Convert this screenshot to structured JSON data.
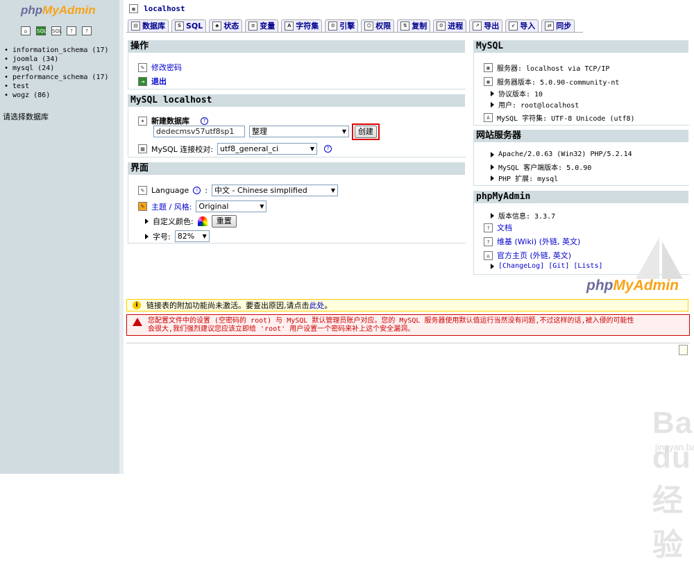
{
  "left": {
    "logo_a": "php",
    "logo_b": "MyAdmin",
    "nav_icons": [
      "home-icon",
      "sql-query-icon",
      "sql-icon",
      "docs-icon",
      "help-icon"
    ],
    "databases": [
      "information_schema (17)",
      "joomla (34)",
      "mysql (24)",
      "performance_schema (17)",
      "test",
      "wogz (86)"
    ],
    "select_db": "请选择数据库"
  },
  "header": {
    "server": "localhost",
    "tabs": [
      "数据库",
      "SQL",
      "状态",
      "变量",
      "字符集",
      "引擎",
      "权限",
      "复制",
      "进程",
      "导出",
      "导入",
      "同步"
    ]
  },
  "operations": {
    "title": "操作",
    "change_password": "修改密码",
    "logout": "退出"
  },
  "mysql_local": {
    "title": "MySQL localhost",
    "create_db_label": "新建数据库",
    "db_name_value": "dedecmsv57utf8sp1",
    "collation_select": "整理",
    "create_button": "创建",
    "conn_collation_label": "MySQL 连接校对:",
    "conn_collation_value": "utf8_general_ci"
  },
  "interface": {
    "title": "界面",
    "language_label": "Language",
    "language_value": "中文 - Chinese simplified",
    "theme_label": "主题 / 风格:",
    "theme_value": "Original",
    "custom_color_label": "自定义颜色:",
    "reset_button": "重置",
    "font_size_label": "字号:",
    "font_size_value": "82%"
  },
  "mysql_info": {
    "title": "MySQL",
    "server": "服务器: localhost via TCP/IP",
    "server_version": "服务器版本: 5.0.90-community-nt",
    "protocol": "协议版本: 10",
    "user": "用户: root@localhost",
    "charset": "MySQL 字符集: UTF-8 Unicode (utf8)"
  },
  "web_server": {
    "title": "网站服务器",
    "apache": "Apache/2.0.63 (Win32) PHP/5.2.14",
    "client": "MySQL 客户端版本: 5.0.90",
    "php_ext": "PHP 扩展: mysql"
  },
  "pma": {
    "title": "phpMyAdmin",
    "version": "版本信息: 3.3.7",
    "docs": "文档",
    "wiki": "维基 (Wiki) (外链, 英文)",
    "homepage": "官方主页 (外链, 英文)",
    "changelog": "[ChangeLog]",
    "git": "[Git]",
    "lists": "[Lists]"
  },
  "notice": {
    "text": "链接表的附加功能尚未激活。要查出原因,请点击",
    "link": "此处",
    "end": "。"
  },
  "warning": {
    "line1": "您配置文件中的设置 (空密码的 root) 与 MySQL 默认管理员账户对应。您的 MySQL 服务器使用默认值运行当然没有问题,不过这样的话,被入侵的可能性",
    "line2": "会很大,我们强烈建议您应该立即给 'root' 用户设置一个密码来补上这个安全漏洞。"
  },
  "watermark": {
    "brand": "Bai du 经验",
    "url": "jingyan.baidu.com"
  },
  "colors": {
    "accent": "#00008b",
    "panel": "#d0dce0",
    "warn": "#cc0000",
    "highlight": "#dd0000"
  }
}
